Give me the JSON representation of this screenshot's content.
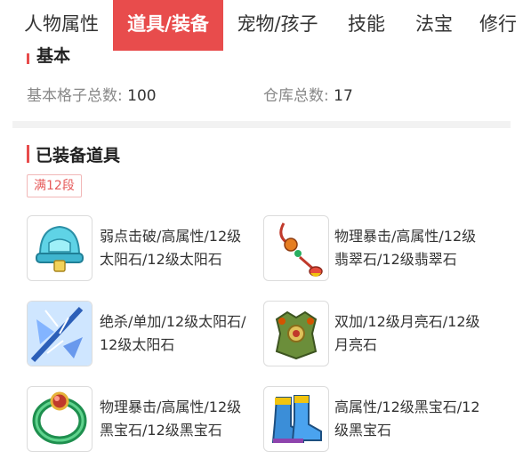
{
  "tabs": [
    {
      "label": "人物属性",
      "active": false
    },
    {
      "label": "道具/装备",
      "active": true
    },
    {
      "label": "宠物/孩子",
      "active": false
    },
    {
      "label": "技能",
      "active": false
    },
    {
      "label": "法宝",
      "active": false
    },
    {
      "label": "修行",
      "active": false
    }
  ],
  "basic": {
    "title": "基本",
    "slots_label": "基本格子总数:",
    "slots_value": "100",
    "warehouse_label": "仓库总数:",
    "warehouse_value": "17"
  },
  "equipped": {
    "title": "已装备道具",
    "badge": "满12段",
    "items": [
      {
        "icon": "helmet-icon",
        "text": "弱点击破/高属性/12级太阳石/12级太阳石"
      },
      {
        "icon": "necklace-icon",
        "text": "物理暴击/高属性/12级翡翠石/12级翡翠石"
      },
      {
        "icon": "weapon-icon",
        "text": "绝杀/单加/12级太阳石/12级太阳石"
      },
      {
        "icon": "armor-icon",
        "text": "双加/12级月亮石/12级月亮石"
      },
      {
        "icon": "jade-ring-icon",
        "text": "物理暴击/高属性/12级黑宝石/12级黑宝石"
      },
      {
        "icon": "boots-icon",
        "text": "高属性/12级黑宝石/12级黑宝石"
      }
    ]
  },
  "colors": {
    "accent": "#e84c4c",
    "badge_border": "#f1b7b7"
  }
}
